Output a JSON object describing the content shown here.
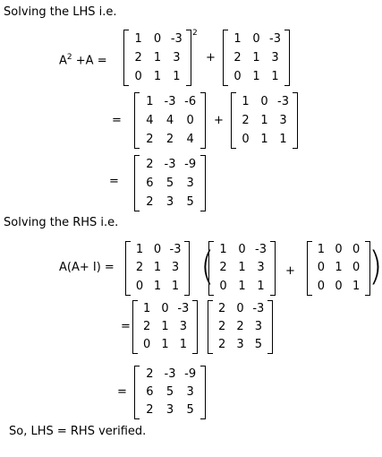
{
  "lhs_heading": "Solving the LHS i.e.",
  "lhs_expr": "A",
  "lhs_expr_exp": "2",
  "lhs_expr_rest": " +A =",
  "square_exp": "2",
  "plus": "+",
  "equals": "=",
  "rhs_heading": "Solving the RHS i.e.",
  "rhs_expr": "A(A+ I) =",
  "open_paren": "(",
  "close_paren": ")",
  "conclusion": "So, LHS = RHS verified.",
  "matrices": {
    "A_1": [
      [
        "1",
        "0",
        "-3"
      ],
      [
        "2",
        "1",
        "3"
      ],
      [
        "0",
        "1",
        "1"
      ]
    ],
    "A_2": [
      [
        "1",
        "0",
        "-3"
      ],
      [
        "2",
        "1",
        "3"
      ],
      [
        "0",
        "1",
        "1"
      ]
    ],
    "A_squared": [
      [
        "1",
        "-3",
        "-6"
      ],
      [
        "4",
        "4",
        "0"
      ],
      [
        "2",
        "2",
        "4"
      ]
    ],
    "A_3": [
      [
        "1",
        "0",
        "-3"
      ],
      [
        "2",
        "1",
        "3"
      ],
      [
        "0",
        "1",
        "1"
      ]
    ],
    "lhs_result": [
      [
        "2",
        "-3",
        "-9"
      ],
      [
        "6",
        "5",
        "3"
      ],
      [
        "2",
        "3",
        "5"
      ]
    ],
    "A_4": [
      [
        "1",
        "0",
        "-3"
      ],
      [
        "2",
        "1",
        "3"
      ],
      [
        "0",
        "1",
        "1"
      ]
    ],
    "A_5": [
      [
        "1",
        "0",
        "-3"
      ],
      [
        "2",
        "1",
        "3"
      ],
      [
        "0",
        "1",
        "1"
      ]
    ],
    "I": [
      [
        "1",
        "0",
        "0"
      ],
      [
        "0",
        "1",
        "0"
      ],
      [
        "0",
        "0",
        "1"
      ]
    ],
    "A_6": [
      [
        "1",
        "0",
        "-3"
      ],
      [
        "2",
        "1",
        "3"
      ],
      [
        "0",
        "1",
        "1"
      ]
    ],
    "A_plus_I": [
      [
        "2",
        "0",
        "-3"
      ],
      [
        "2",
        "2",
        "3"
      ],
      [
        "2",
        "3",
        "5"
      ]
    ],
    "rhs_result": [
      [
        "2",
        "-3",
        "-9"
      ],
      [
        "6",
        "5",
        "3"
      ],
      [
        "2",
        "3",
        "5"
      ]
    ]
  }
}
